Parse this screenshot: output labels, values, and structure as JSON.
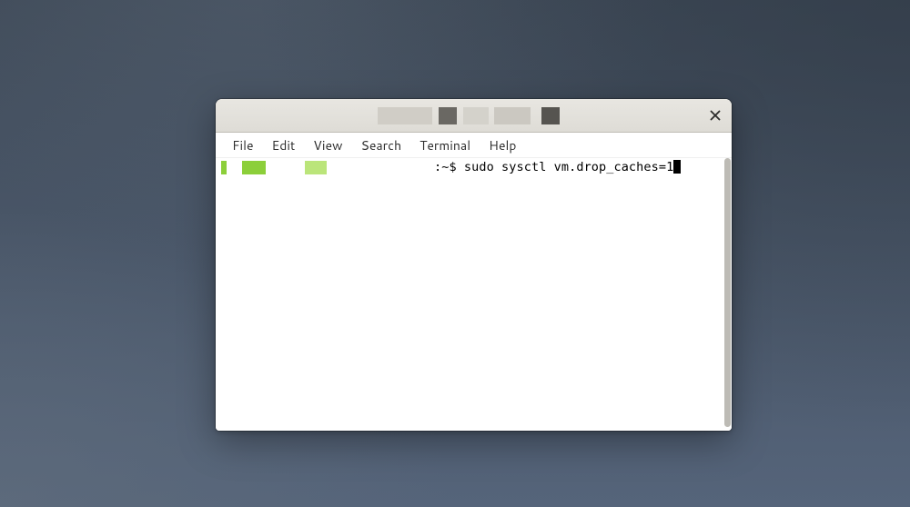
{
  "menu": {
    "file": "File",
    "edit": "Edit",
    "view": "View",
    "search": "Search",
    "terminal": "Terminal",
    "help": "Help"
  },
  "terminal": {
    "prompt_suffix": ":~$ ",
    "command": "sudo sysctl vm.drop_caches=1"
  }
}
